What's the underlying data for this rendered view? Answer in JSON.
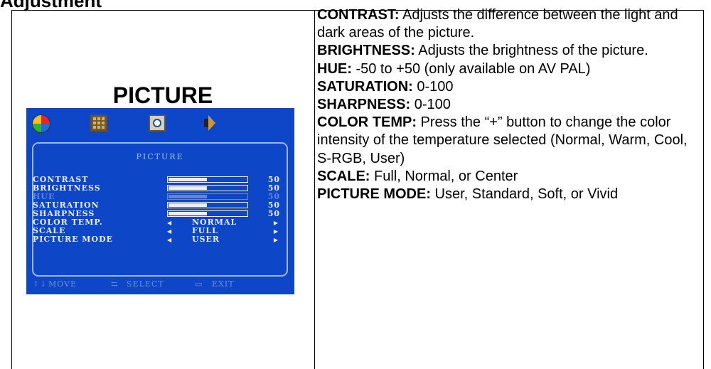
{
  "heading": "Adjustment",
  "picture_title": "PICTURE",
  "osd": {
    "menu_title": "PICTURE",
    "icons": [
      "color-wheel-icon",
      "picture-grid-icon",
      "clock-icon",
      "speaker-icon"
    ],
    "rows": [
      {
        "label": "CONTRAST",
        "value": "50",
        "level": 0.5,
        "enabled": true
      },
      {
        "label": "BRIGHTNESS",
        "value": "50",
        "level": 0.5,
        "enabled": true
      },
      {
        "label": "HUE",
        "value": "50",
        "level": 0.5,
        "enabled": false
      },
      {
        "label": "SATURATION",
        "value": "50",
        "level": 0.5,
        "enabled": true
      },
      {
        "label": "SHARPNESS",
        "value": "50",
        "level": 0.5,
        "enabled": true
      }
    ],
    "options": [
      {
        "label": "COLOR TEMP.",
        "value": "NORMAL"
      },
      {
        "label": "SCALE",
        "value": "FULL"
      },
      {
        "label": "PICTURE MODE",
        "value": "USER"
      }
    ],
    "footer": {
      "move": "MOVE",
      "select": "SELECT",
      "exit": "EXIT"
    },
    "colors": {
      "background": "#0d46c7",
      "text": "#e8eeff",
      "dim": "#5f86de"
    }
  },
  "descriptions": [
    {
      "term": "CONTRAST:",
      "text": " Adjusts the difference between the light and dark areas of the picture."
    },
    {
      "term": "BRIGHTNESS:",
      "text": " Adjusts the brightness of the picture."
    },
    {
      "term": "HUE:",
      "text": " -50 to +50 (only available on AV PAL)"
    },
    {
      "term": "SATURATION:",
      "text": " 0-100"
    },
    {
      "term": "SHARPNESS:",
      "text": " 0-100"
    },
    {
      "term": "COLOR TEMP:",
      "text": " Press the “+” button to change the color intensity of the temperature selected (Normal, Warm, Cool, S-RGB, User)"
    },
    {
      "term": "SCALE:",
      "text": " Full, Normal, or Center"
    },
    {
      "term": "PICTURE MODE:",
      "text": " User, Standard, Soft, or Vivid"
    }
  ]
}
